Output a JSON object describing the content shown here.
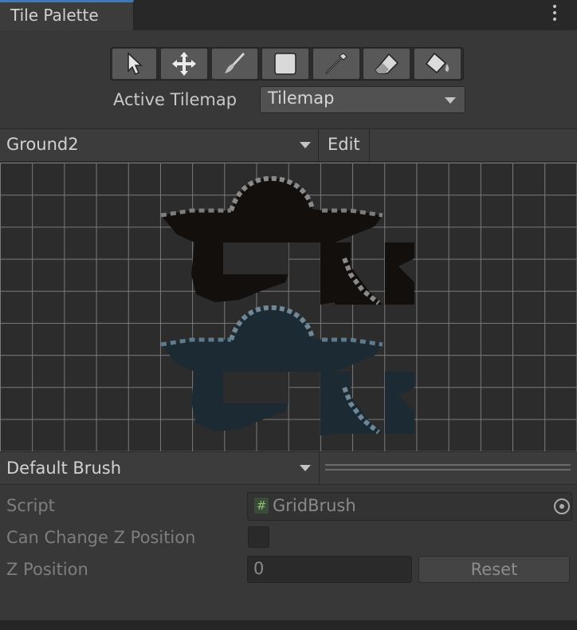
{
  "tab": {
    "title": "Tile Palette"
  },
  "toolbar": {
    "tools": [
      "select-tool",
      "move-tool",
      "paint-brush-tool",
      "box-fill-tool",
      "picker-tool",
      "eraser-tool",
      "flood-fill-tool"
    ]
  },
  "active_tilemap": {
    "label": "Active Tilemap",
    "value": "Tilemap"
  },
  "palette": {
    "name": "Ground2",
    "edit_label": "Edit"
  },
  "brush": {
    "name": "Default Brush"
  },
  "properties": {
    "script_label": "Script",
    "script_value": "GridBrush",
    "script_icon": "#",
    "change_z_label": "Can Change Z Position",
    "change_z_checked": false,
    "z_label": "Z Position",
    "z_value": "0",
    "reset_label": "Reset"
  },
  "colors": {
    "accent": "#3a79bb",
    "panel": "#383838",
    "grid_line": "#7a7a7a",
    "tile_dark": "#120f0d",
    "tile_blue": "#1c2a34",
    "tile_edge": "#8a8a8a"
  }
}
